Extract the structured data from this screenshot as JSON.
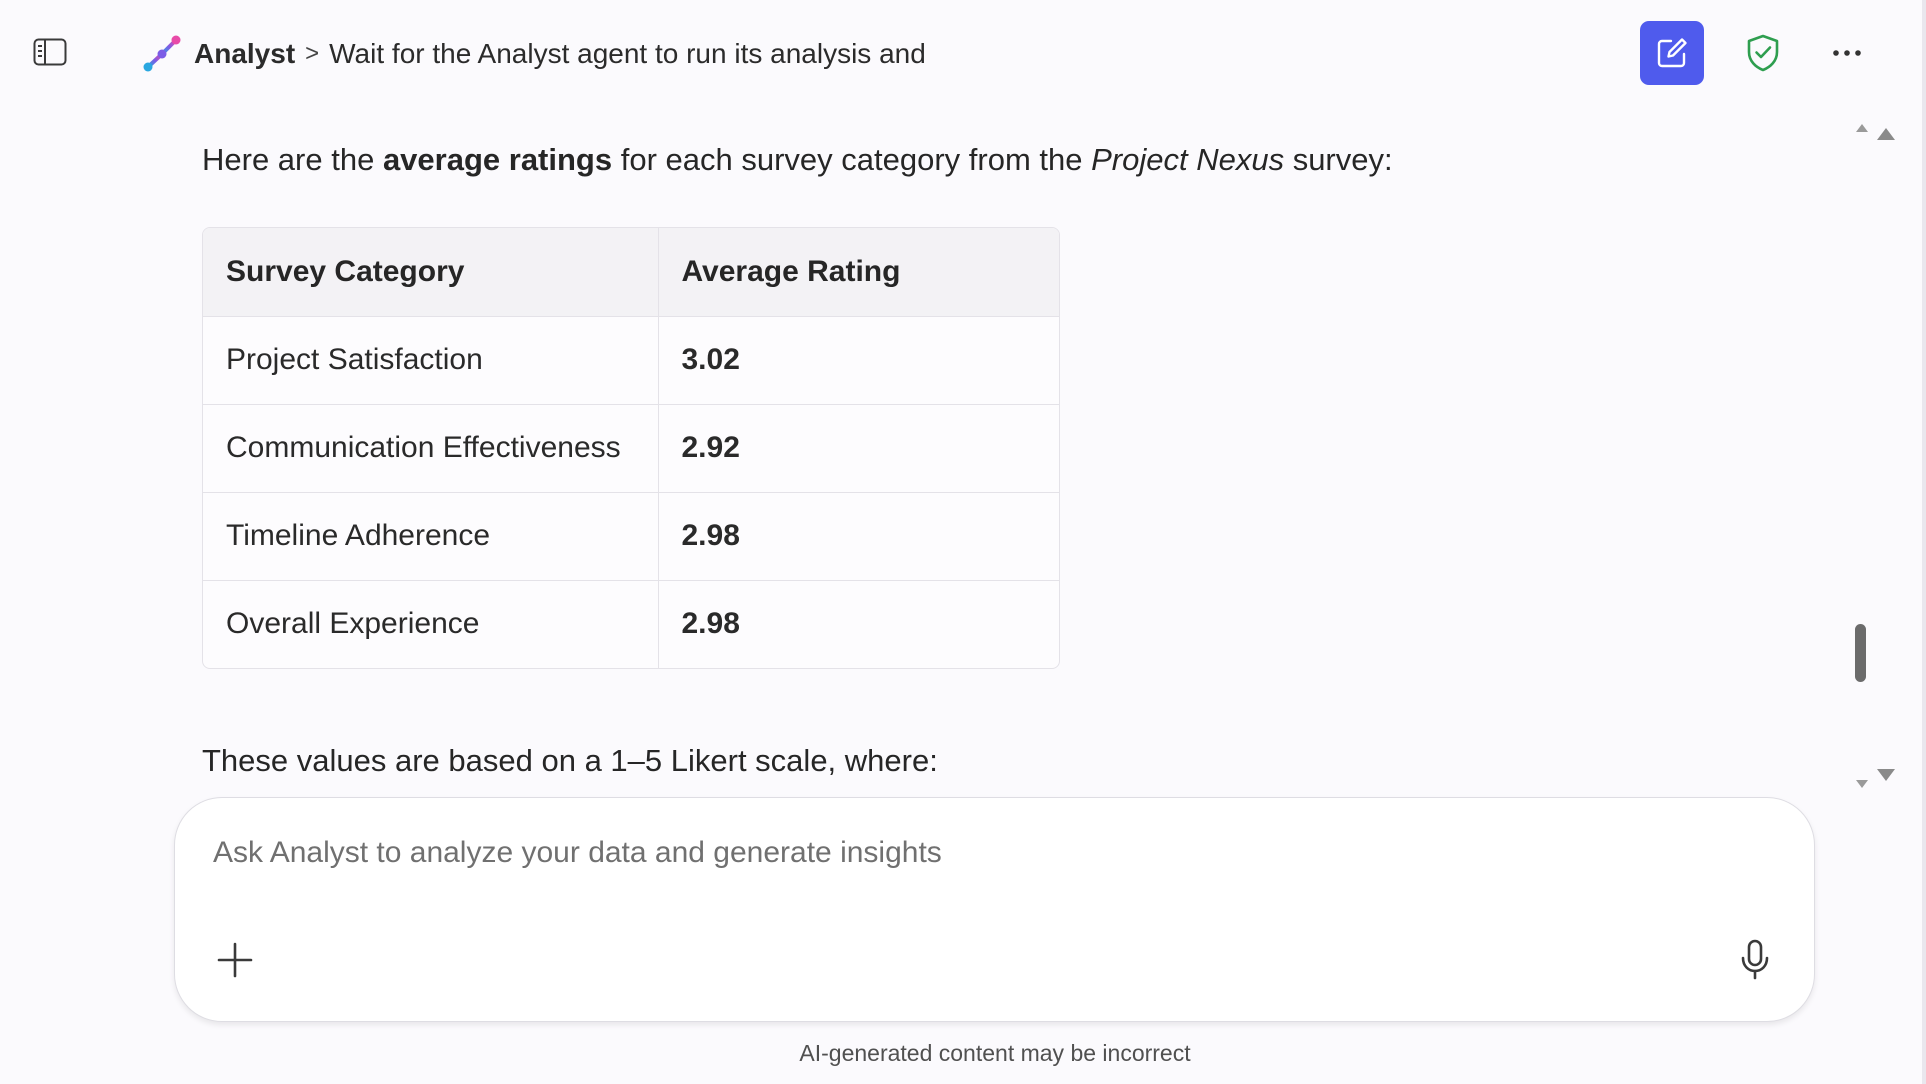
{
  "header": {
    "app_name": "Analyst",
    "separator": ">",
    "conversation_title": "Wait for the Analyst agent to run its analysis and"
  },
  "message": {
    "intro_prefix": "Here are the ",
    "intro_bold": "average ratings",
    "intro_middle": " for each survey category from the ",
    "intro_italic": "Project Nexus",
    "intro_suffix": " survey:",
    "table": {
      "headers": [
        "Survey Category",
        "Average Rating"
      ],
      "rows": [
        {
          "category": "Project Satisfaction",
          "rating": "3.02"
        },
        {
          "category": "Communication Effectiveness",
          "rating": "2.92"
        },
        {
          "category": "Timeline Adherence",
          "rating": "2.98"
        },
        {
          "category": "Overall Experience",
          "rating": "2.98"
        }
      ]
    },
    "followup": "These values are based on a 1–5 Likert scale, where:"
  },
  "composer": {
    "placeholder": "Ask Analyst to analyze your data and generate insights"
  },
  "footer": {
    "disclaimer": "AI-generated content may be incorrect"
  },
  "icons": {
    "sidebar_toggle": "sidebar-toggle-icon",
    "app_logo": "analyst-logo-icon",
    "new_chat": "compose-icon",
    "shield": "shield-check-icon",
    "more": "more-horizontal-icon",
    "attach": "plus-icon",
    "mic": "microphone-icon"
  },
  "colors": {
    "accent": "#4f5bed",
    "shield": "#2e9e4f",
    "background": "#fbfafd"
  }
}
